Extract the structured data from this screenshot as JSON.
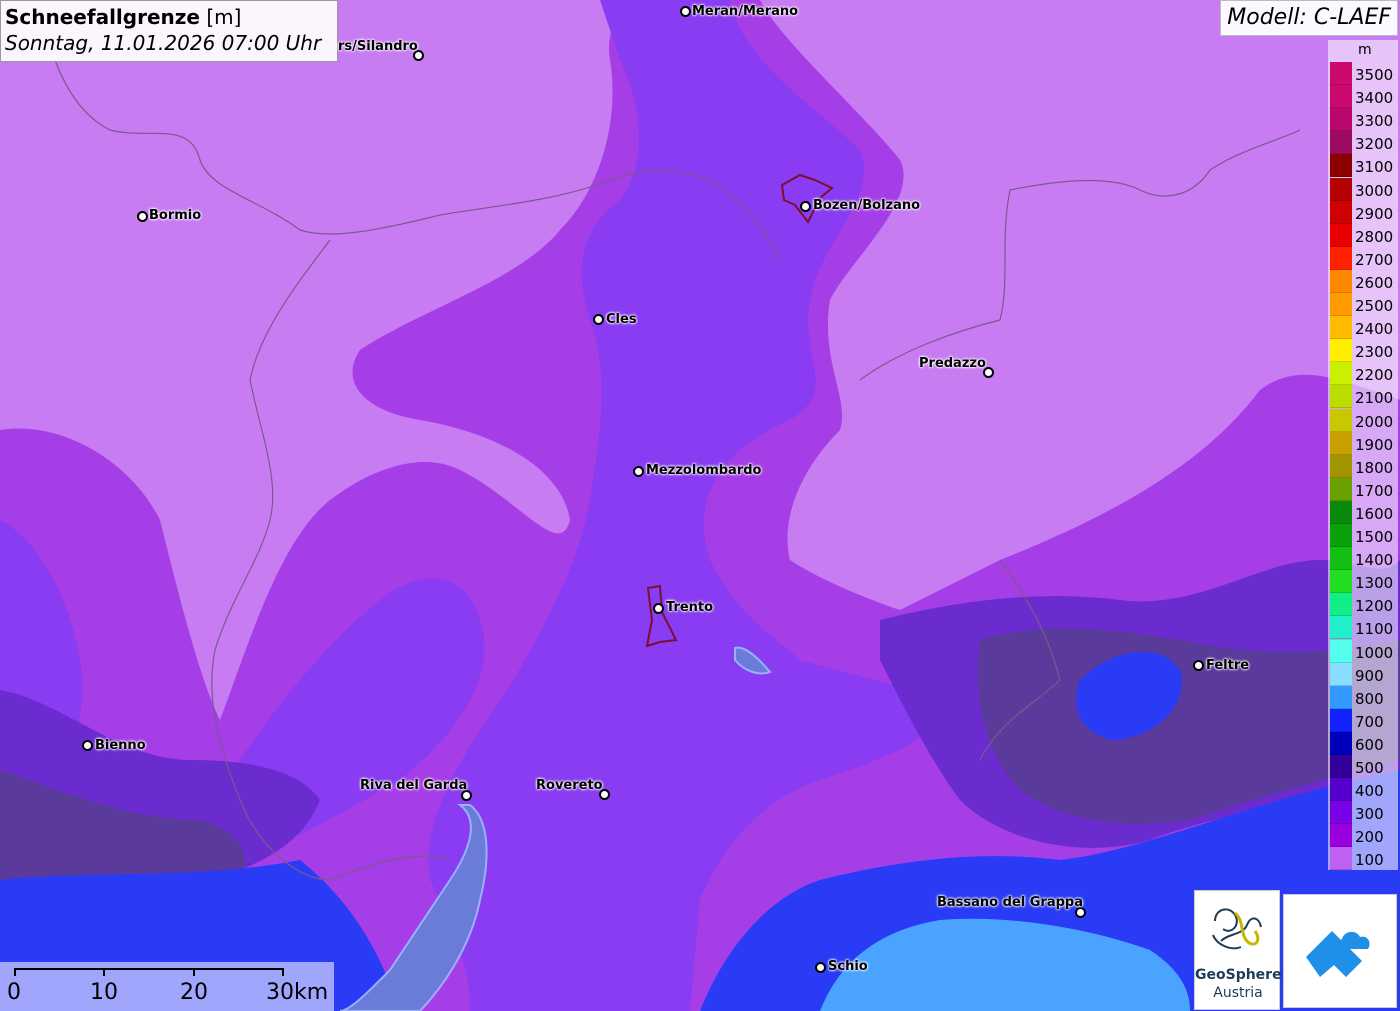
{
  "header": {
    "title": "Schneefallgrenze",
    "unit": "[m]",
    "datetime": "Sonntag, 11.01.2026 07:00 Uhr"
  },
  "model": "Modell: C-LAEF",
  "legend": {
    "unit": "m",
    "items": [
      {
        "label": "3500",
        "color": "#cc0a6e"
      },
      {
        "label": "3400",
        "color": "#c9096e"
      },
      {
        "label": "3300",
        "color": "#b8086e"
      },
      {
        "label": "3200",
        "color": "#9c0a62"
      },
      {
        "label": "3100",
        "color": "#8c0000"
      },
      {
        "label": "3000",
        "color": "#b30000"
      },
      {
        "label": "2900",
        "color": "#cf0000"
      },
      {
        "label": "2800",
        "color": "#e80000"
      },
      {
        "label": "2700",
        "color": "#ff2200"
      },
      {
        "label": "2600",
        "color": "#ff8800"
      },
      {
        "label": "2500",
        "color": "#ff9a00"
      },
      {
        "label": "2400",
        "color": "#ffbb00"
      },
      {
        "label": "2300",
        "color": "#ffee00"
      },
      {
        "label": "2200",
        "color": "#c8f000"
      },
      {
        "label": "2100",
        "color": "#bbdd00"
      },
      {
        "label": "2000",
        "color": "#c8c800"
      },
      {
        "label": "1900",
        "color": "#c8a000"
      },
      {
        "label": "1800",
        "color": "#a09400"
      },
      {
        "label": "1700",
        "color": "#6aa000"
      },
      {
        "label": "1600",
        "color": "#0a8a0a"
      },
      {
        "label": "1500",
        "color": "#0aa00a"
      },
      {
        "label": "1400",
        "color": "#11c011"
      },
      {
        "label": "1300",
        "color": "#22dd22"
      },
      {
        "label": "1200",
        "color": "#11ee88"
      },
      {
        "label": "1100",
        "color": "#22eecc"
      },
      {
        "label": "1000",
        "color": "#55ffee"
      },
      {
        "label": "900",
        "color": "#88ddff"
      },
      {
        "label": "800",
        "color": "#3399ff"
      },
      {
        "label": "700",
        "color": "#1122ff"
      },
      {
        "label": "600",
        "color": "#0000bb"
      },
      {
        "label": "500",
        "color": "#330099"
      },
      {
        "label": "400",
        "color": "#5500cc"
      },
      {
        "label": "300",
        "color": "#7a00e6"
      },
      {
        "label": "200",
        "color": "#9900dd"
      },
      {
        "label": "100",
        "color": "#c060f0"
      }
    ]
  },
  "cities": [
    {
      "name": "Meran/Merano"
    },
    {
      "name": "rs/Silandro"
    },
    {
      "name": "Bormio"
    },
    {
      "name": "Bozen/Bolzano"
    },
    {
      "name": "Cles"
    },
    {
      "name": "Predazzo"
    },
    {
      "name": "Mezzolombardo"
    },
    {
      "name": "Trento"
    },
    {
      "name": "Feltre"
    },
    {
      "name": "Bienno"
    },
    {
      "name": "Riva del Garda"
    },
    {
      "name": "Rovereto"
    },
    {
      "name": "Bassano del Grappa"
    },
    {
      "name": "Schio"
    }
  ],
  "scalebar": {
    "labels": [
      "0",
      "10",
      "20",
      "30km"
    ]
  },
  "logos": {
    "geosphere_name": "GeoSphere",
    "geosphere_sub": "Austria"
  },
  "colors": {
    "base_100": "#c77cf2",
    "band_200": "#a63ee8",
    "band_300": "#8a38f0",
    "band_400": "#6a2ccf",
    "band_500": "#5a3a9a",
    "band_700": "#2a3bf5",
    "band_800": "#4aa3ff"
  }
}
